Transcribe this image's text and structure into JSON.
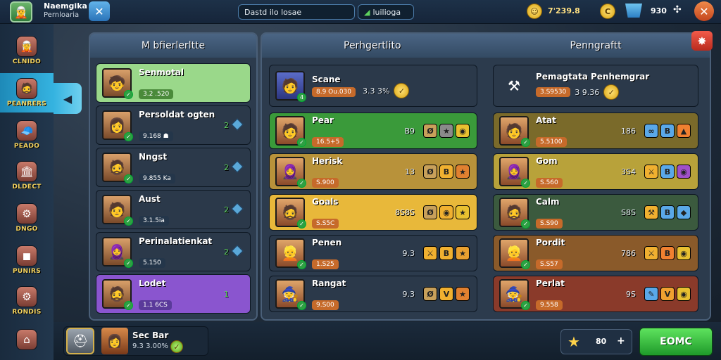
{
  "topbar": {
    "player_name": "Naemgika",
    "player_sub": "Pernloaria",
    "close_glyph": "✕",
    "search_value": "Dastd ilo losae",
    "filter_label": "luilioga",
    "gold_amount": "7ˈ239.8",
    "gems_amount": "930",
    "coin_glyph": "☺",
    "gem_glyph": "C"
  },
  "sidebar": {
    "items": [
      {
        "label": "CLNIDO",
        "icon": "🧝"
      },
      {
        "label": "PEANRERS",
        "icon": "🧔"
      },
      {
        "label": "PEADO",
        "icon": "🧢"
      },
      {
        "label": "DLDECT",
        "icon": "🏛"
      },
      {
        "label": "DNGO",
        "icon": "⚙"
      },
      {
        "label": "PUNIRS",
        "icon": "◼"
      },
      {
        "label": "RONDIS",
        "icon": "⚙"
      },
      {
        "label": "",
        "icon": "⌂"
      }
    ],
    "active_index": 1
  },
  "left_panel": {
    "title": "M bfierlerltte",
    "rows": [
      {
        "name": "Senmotal",
        "sub": "3.2 .520",
        "value": "",
        "color": "#9ad88a"
      },
      {
        "name": "Persoldat ogten",
        "sub": "9.168 ☗",
        "value": "2",
        "color": "#2b394a"
      },
      {
        "name": "Nngst",
        "sub": "9.855 Ka",
        "value": "2",
        "color": "#2b394a"
      },
      {
        "name": "Aust",
        "sub": "3.1.5ia",
        "value": "2",
        "color": "#2b394a"
      },
      {
        "name": "Perinalatienkat",
        "sub": "5.150",
        "value": "2",
        "color": "#2b394a"
      },
      {
        "name": "Lodet",
        "sub": "1.1 6CS",
        "value": "1",
        "color": "#8a55cf"
      }
    ]
  },
  "middle_panel": {
    "title": "Perhgertlito",
    "featured": {
      "name": "Scane",
      "sub": "8.9 Ou.030",
      "stat": "3.3 3%"
    },
    "rows": [
      {
        "name": "Pear",
        "sub": "16.5+5",
        "value": "B9",
        "color": "#3a9a3a"
      },
      {
        "name": "Herisk",
        "sub": "S.900",
        "value": "13",
        "color": "#b8923a"
      },
      {
        "name": "Goals",
        "sub": "S.S5C",
        "value": "8S8S",
        "color": "#e8b83a"
      },
      {
        "name": "Penen",
        "sub": "1.S25",
        "value": "9.3",
        "color": "#2b394a"
      },
      {
        "name": "Rangat",
        "sub": "9.S00",
        "value": "9.3",
        "color": "#2b394a"
      }
    ]
  },
  "right_panel": {
    "title": "Penngraftt",
    "featured": {
      "name": "Pemagtata Penhemgrar",
      "sub": "3.S9530",
      "stat": "3 9.36"
    },
    "rows": [
      {
        "name": "Atat",
        "sub": "5.5100",
        "value": "186",
        "color": "#7a6a2a"
      },
      {
        "name": "Gom",
        "sub": "S.560",
        "value": "3S4",
        "color": "#b8a23a"
      },
      {
        "name": "Calm",
        "sub": "S.S90",
        "value": "S8S",
        "color": "#3b5a3e"
      },
      {
        "name": "Pordit",
        "sub": "S.S57",
        "value": "786",
        "color": "#8a5a2a"
      },
      {
        "name": "Perlat",
        "sub": "9.558",
        "value": "9S",
        "color": "#8a3a2a"
      }
    ]
  },
  "bottom": {
    "profile_name": "Sec Bar",
    "profile_sub": "9.3 3.00%",
    "count_value": "80",
    "plus_label": "+",
    "go_label": "EOMC"
  }
}
